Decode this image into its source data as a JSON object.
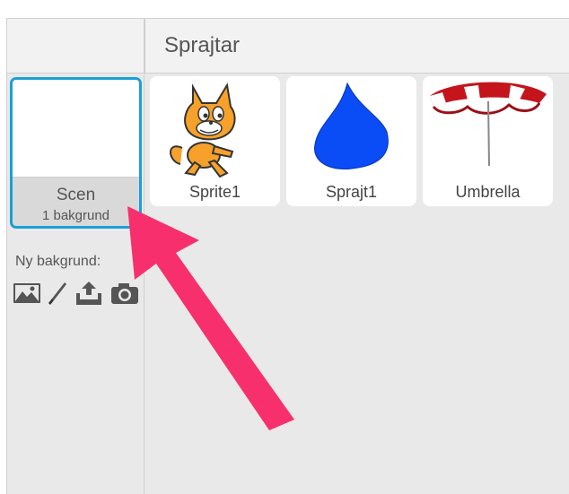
{
  "header": {
    "sprites_title": "Sprajtar"
  },
  "stage": {
    "name": "Scen",
    "backdrop_count": "1 bakgrund",
    "selected_color": "#1aa0d8"
  },
  "new_backdrop": {
    "label": "Ny bakgrund:",
    "tools": [
      "landscape-icon",
      "paintbrush-icon",
      "upload-icon",
      "camera-icon"
    ]
  },
  "sprites": [
    {
      "name": "Sprite1",
      "icon": "scratch-cat-icon"
    },
    {
      "name": "Sprajt1",
      "icon": "blue-drop-icon"
    },
    {
      "name": "Umbrella",
      "icon": "umbrella-icon"
    }
  ],
  "annotation": {
    "arrow_color": "#f7306d"
  }
}
